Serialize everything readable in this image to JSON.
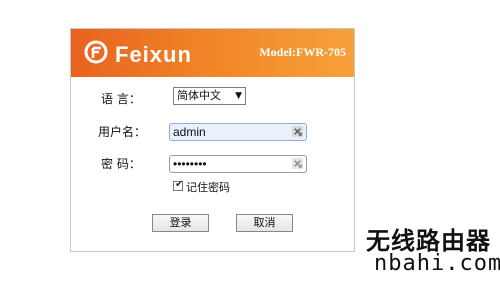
{
  "header": {
    "brand": "Feixun",
    "model": "Model:FWR-705"
  },
  "form": {
    "language_label": "语 言：",
    "language_value": "简体中文",
    "username_label": "用户名：",
    "username_value": "admin",
    "password_label": "密 码：",
    "password_value": "••••••••",
    "remember_label": "记住密码",
    "login_button": "登录",
    "cancel_button": "取消"
  },
  "watermark": {
    "line1": "无线路由器",
    "line2": "nbahi.com"
  },
  "colors": {
    "header_start": "#e8621f",
    "header_end": "#f6a13a"
  }
}
